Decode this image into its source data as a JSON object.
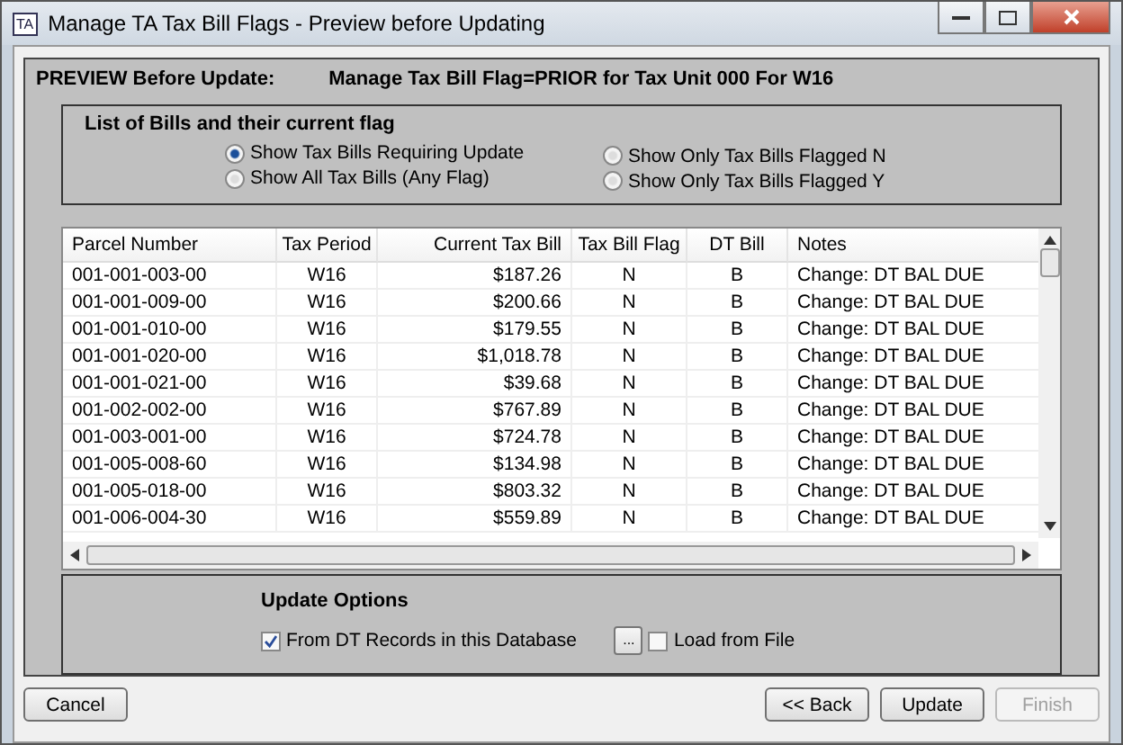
{
  "window": {
    "title": "Manage TA Tax Bill Flags - Preview before Updating",
    "app_icon": "TA"
  },
  "header": {
    "label": "PREVIEW Before Update:",
    "value": "Manage Tax Bill Flag=PRIOR for Tax Unit 000 For  W16"
  },
  "filter_group": {
    "title": "List of Bills and their current flag",
    "options": [
      {
        "label": "Show Tax Bills Requiring Update",
        "selected": true
      },
      {
        "label": "Show All Tax Bills (Any Flag)",
        "selected": false
      },
      {
        "label": "Show Only Tax Bills Flagged N",
        "selected": false
      },
      {
        "label": "Show Only Tax Bills Flagged Y",
        "selected": false
      }
    ]
  },
  "table": {
    "columns": [
      "Parcel Number",
      "Tax Period",
      "Current Tax Bill",
      "Tax Bill Flag",
      "DT Bill",
      "Notes"
    ],
    "rows": [
      [
        "001-001-003-00",
        "W16",
        "$187.26",
        "N",
        "B",
        "Change: DT BAL DUE"
      ],
      [
        "001-001-009-00",
        "W16",
        "$200.66",
        "N",
        "B",
        "Change: DT BAL DUE"
      ],
      [
        "001-001-010-00",
        "W16",
        "$179.55",
        "N",
        "B",
        "Change: DT BAL DUE"
      ],
      [
        "001-001-020-00",
        "W16",
        "$1,018.78",
        "N",
        "B",
        "Change: DT BAL DUE"
      ],
      [
        "001-001-021-00",
        "W16",
        "$39.68",
        "N",
        "B",
        "Change: DT BAL DUE"
      ],
      [
        "001-002-002-00",
        "W16",
        "$767.89",
        "N",
        "B",
        "Change: DT BAL DUE"
      ],
      [
        "001-003-001-00",
        "W16",
        "$724.78",
        "N",
        "B",
        "Change: DT BAL DUE"
      ],
      [
        "001-005-008-60",
        "W16",
        "$134.98",
        "N",
        "B",
        "Change: DT BAL DUE"
      ],
      [
        "001-005-018-00",
        "W16",
        "$803.32",
        "N",
        "B",
        "Change: DT BAL DUE"
      ],
      [
        "001-006-004-30",
        "W16",
        "$559.89",
        "N",
        "B",
        "Change: DT BAL DUE"
      ]
    ]
  },
  "update_options": {
    "title": "Update Options",
    "from_db": {
      "label": "From DT Records in this Database",
      "checked": true
    },
    "browse_button": "...",
    "load_file": {
      "label": "Load from File",
      "checked": false
    }
  },
  "buttons": [
    {
      "label": "Cancel",
      "disabled": false
    },
    {
      "label": "<< Back",
      "disabled": false
    },
    {
      "label": "Update",
      "disabled": false
    },
    {
      "label": "Finish",
      "disabled": true
    }
  ]
}
